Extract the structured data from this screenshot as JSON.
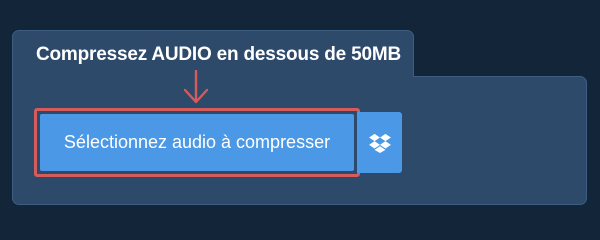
{
  "card": {
    "title": "Compressez AUDIO en dessous de 50MB"
  },
  "actions": {
    "select_label": "Sélectionnez audio à compresser",
    "dropbox_icon": "dropbox-icon",
    "arrow_icon": "arrow-down-icon"
  },
  "colors": {
    "page_background": "#132538",
    "card_background": "#2d4a6b",
    "button_blue": "#4b98e6",
    "highlight_red": "#d65b5b"
  }
}
